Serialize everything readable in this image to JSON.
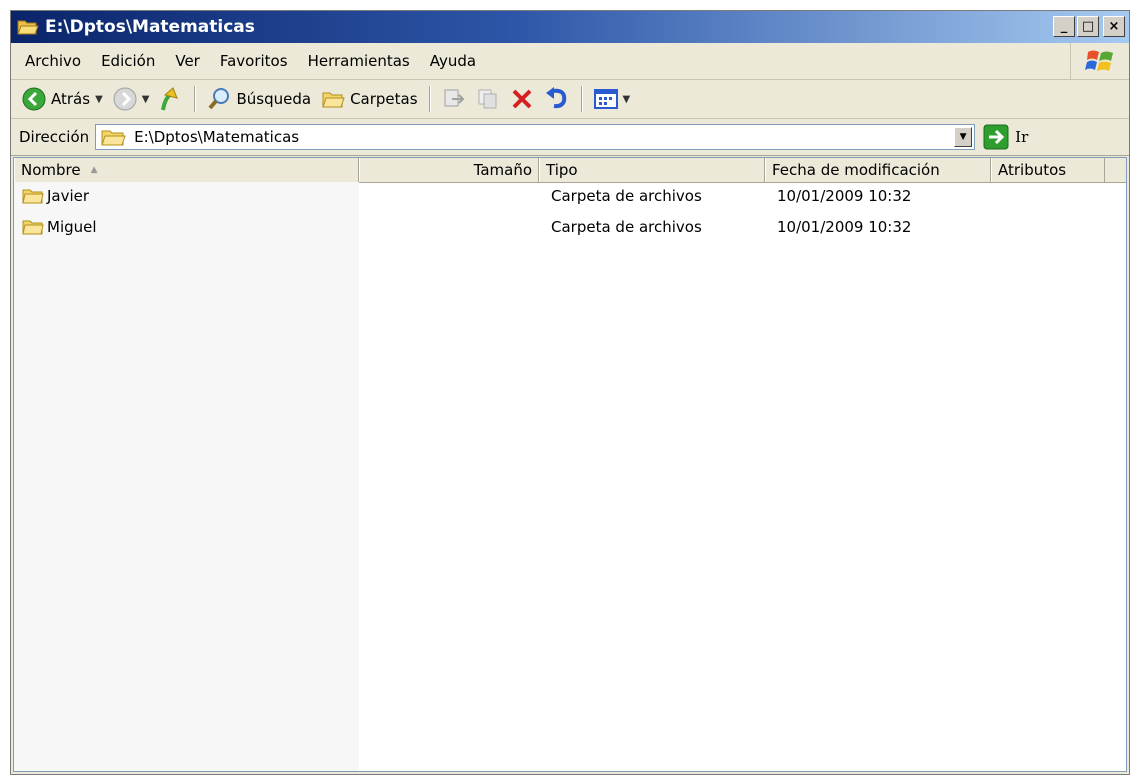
{
  "window": {
    "title": "E:\\Dptos\\Matematicas",
    "minimize_glyph": "_",
    "maximize_glyph": "□",
    "close_glyph": "×"
  },
  "menu": {
    "items": [
      "Archivo",
      "Edición",
      "Ver",
      "Favoritos",
      "Herramientas",
      "Ayuda"
    ]
  },
  "toolbar": {
    "back_label": "Atrás",
    "search_label": "Búsqueda",
    "folders_label": "Carpetas"
  },
  "address": {
    "label": "Dirección",
    "value": "E:\\Dptos\\Matematicas",
    "go_label": "Ir"
  },
  "list": {
    "columns": [
      "Nombre",
      "Tamaño",
      "Tipo",
      "Fecha de modificación",
      "Atributos"
    ],
    "rows": [
      {
        "name": "Javier",
        "size": "",
        "type": "Carpeta de archivos",
        "date": "10/01/2009 10:32",
        "attributes": ""
      },
      {
        "name": "Miguel",
        "size": "",
        "type": "Carpeta de archivos",
        "date": "10/01/2009 10:32",
        "attributes": ""
      }
    ]
  },
  "icons": {
    "title": "folder-open-icon",
    "back": "back-arrow-icon",
    "forward": "forward-arrow-icon",
    "up": "up-folder-icon",
    "search": "search-icon",
    "folders": "folders-icon",
    "move": "move-to-icon",
    "copy": "copy-to-icon",
    "delete": "delete-icon",
    "undo": "undo-icon",
    "views": "views-icon",
    "go": "go-arrow-icon",
    "winlogo": "windows-logo-icon"
  },
  "colors": {
    "title_start": "#0a246a",
    "title_end": "#a6caf0",
    "chrome": "#ece9d8",
    "go_green": "#2e9e2e",
    "delete_red": "#d42020",
    "folder_yellow": "#f4d36a"
  }
}
